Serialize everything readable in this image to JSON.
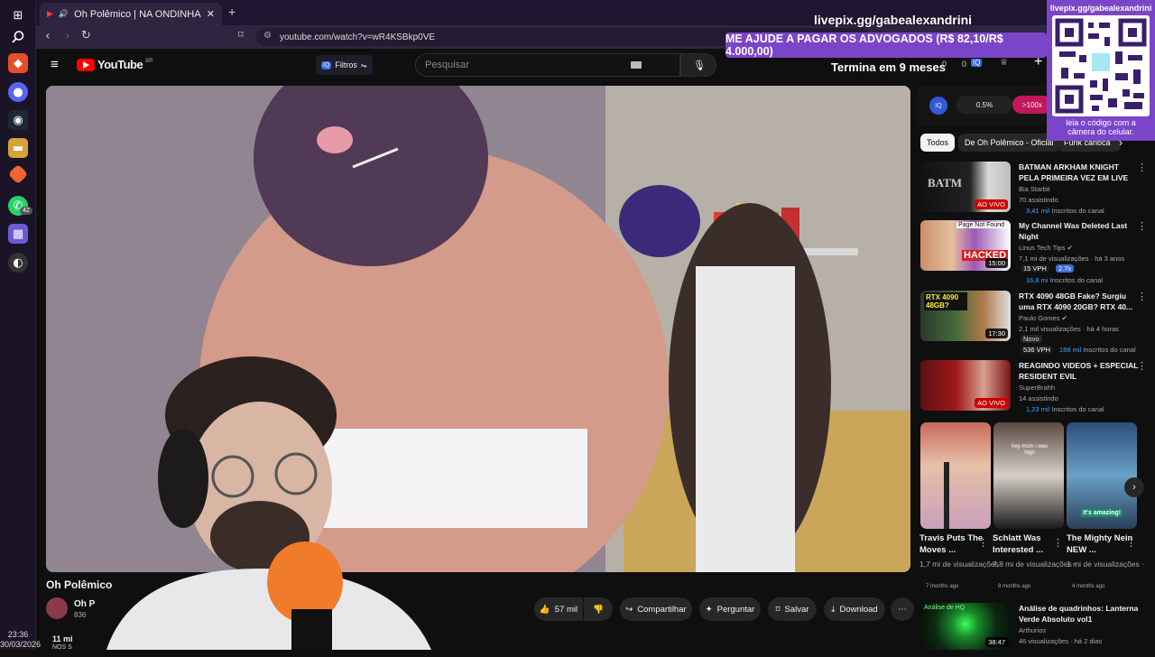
{
  "taskbar": {
    "time": "23:36",
    "date": "30/03/2026",
    "whatsapp_badge": "42"
  },
  "browser": {
    "tab_title": "Oh Polêmico | NA ONDINHA",
    "url": "youtube.com/watch?v=wR4KSBkp0VE"
  },
  "youtube": {
    "logo": "YouTube",
    "region": "BR",
    "filter_label": "Filtros",
    "search_placeholder": "Pesquisar",
    "counter_a": "0",
    "counter_b": "0"
  },
  "stream_overlay": {
    "pix_url": "livepix.gg/gabealexandrini",
    "donation_goal": "ME AJUDE A PAGAR OS ADVOGADOS (R$ 82,10/R$ 4.000,00)",
    "ends_in": "Termina em 9 meses",
    "qr_url": "livepix.gg/gabealexandrini",
    "qr_caption_1": "leia o código com a",
    "qr_caption_2": "câmera do celular."
  },
  "widget": {
    "percent": "0.5%",
    "multiplier": ">100x"
  },
  "chips": [
    "Todos",
    "De Oh Polêmico - Oficial",
    "Funk carioca"
  ],
  "recommendations": [
    {
      "title": "BATMAN ARKHAM KNIGHT PELA PRIMEIRA VEZ EM LIVE",
      "channel": "Bia Starbit",
      "views": "70 assistindo",
      "badge": "AO VIVO",
      "subs_num": "3,41 mil",
      "subs_label": "Inscritos do canal"
    },
    {
      "title": "My Channel Was Deleted Last Night",
      "channel": "Linus Tech Tips",
      "views": "7,1 mi de visualizações · há 3 anos",
      "badge": "15:00",
      "vph": "15 VPH",
      "score": "2.7x",
      "subs_num": "16,8 mi",
      "subs_label": "Inscritos do canal",
      "thumb_text_1": "Page Not Found",
      "thumb_text_2": "HACKED"
    },
    {
      "title": "RTX 4090 48GB Fake? Surgiu uma RTX 4090 20GB? RTX 40...",
      "channel": "Paulo Gomes",
      "views": "2,1 mil visualizações · há 4 horas",
      "badge": "17:30",
      "tag": "Novo",
      "vph": "536 VPH",
      "subs_num": "188 mil",
      "subs_label": "Inscritos do canal",
      "thumb_text": "RTX 4090 48GB?"
    },
    {
      "title": "REAGINDO VIDEOS + ESPECIAL RESIDENT EVIL",
      "channel": "SuperBrahh",
      "views": "14 assistindo",
      "badge": "AO VIVO",
      "subs_num": "1,23 mil",
      "subs_label": "Inscritos do canal"
    },
    {
      "title": "Análise de quadrinhos: Lanterna Verde Absoluto vol1",
      "channel": "Arthurios",
      "views": "46 visualizações · há 2 dias",
      "badge": "38:47",
      "thumb_text": "Análise de HQ"
    }
  ],
  "shorts": [
    {
      "title": "Travis Puts The Moves ...",
      "views": "1,7 mi de visualizações ·",
      "age": "7 months ago"
    },
    {
      "title": "Schlatt Was Interested ...",
      "views": "7,8 mi de visualizações ·",
      "age": "8 months ago",
      "caption": "hey mom i was high"
    },
    {
      "title": "The Mighty Nein NEW ...",
      "views": "1 mi de visualizações ·",
      "age": "4 months ago",
      "caption": "It's amazing!"
    }
  ],
  "video": {
    "title": "Oh Polêmico",
    "channel_partial": "Oh P",
    "subs_partial": "836",
    "views_partial": "11 mi",
    "desc_partial": "NOS S",
    "likes": "57 mil",
    "share": "Compartilhar",
    "ask": "Perguntar",
    "save": "Salvar",
    "download": "Download"
  },
  "colors": {
    "accent_purple": "#7b45c9",
    "youtube_red": "#ff0000",
    "live_red": "#cc0000",
    "link_blue": "#3ea6ff"
  }
}
